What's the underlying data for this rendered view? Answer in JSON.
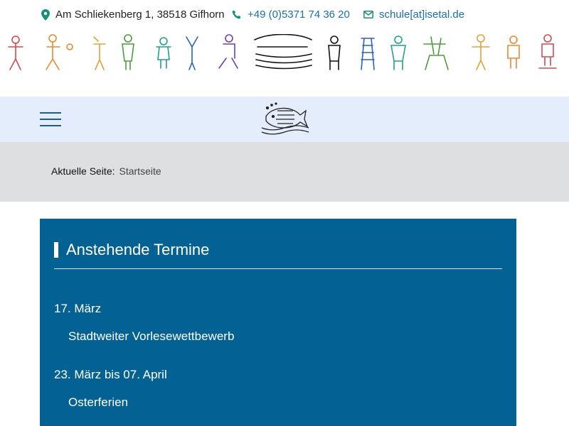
{
  "contact": {
    "address": "Am Schliekenberg 1, 38518 Gifhorn",
    "phone": "+49 (0)5371 74 36 20",
    "email": "schule[at]isetal.de"
  },
  "colors": {
    "panel": "#036293",
    "nav_background": "#e3edfb",
    "breadcrumb_background": "#dedfe0",
    "accent_icon": "#17907a"
  },
  "breadcrumb": {
    "label": "Aktuelle Seite:",
    "current": "Startseite"
  },
  "events": {
    "title": "Anstehende Termine",
    "items": [
      {
        "date": "17. März",
        "title": "Stadtweiter Vorlesewettbewerb"
      },
      {
        "date": "23. März bis 07. April",
        "title": "Osterferien"
      }
    ]
  }
}
